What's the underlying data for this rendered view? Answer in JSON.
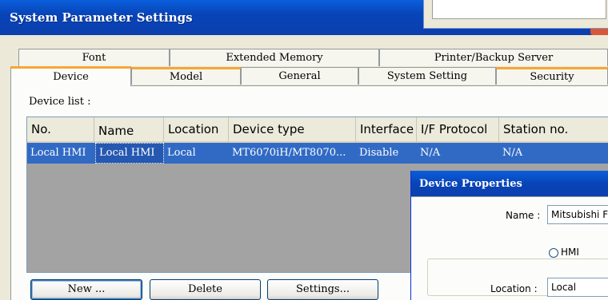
{
  "window": {
    "title": "System Parameter Settings"
  },
  "tabs_back": [
    "Font",
    "Extended Memory",
    "Printer/Backup Server"
  ],
  "tabs_front": [
    "Device",
    "Model",
    "General",
    "System Setting",
    "Security"
  ],
  "active_tab": "Device",
  "device_list": {
    "label": "Device list :",
    "columns": [
      "No.",
      "Name",
      "Location",
      "Device type",
      "Interface",
      "I/F Protocol",
      "Station no."
    ],
    "rows": [
      [
        "Local HMI",
        "Local HMI",
        "Local",
        "MT6070iH/MT8070...",
        "Disable",
        "N/A",
        "N/A"
      ]
    ]
  },
  "buttons": {
    "new": "New ...",
    "delete": "Delete",
    "settings": "Settings..."
  },
  "device_properties": {
    "title": "Device Properties",
    "name_label": "Name :",
    "name_value": "Mitsubishi F",
    "radio_hmi": "HMI",
    "location_label": "Location :",
    "location_value": "Local"
  },
  "colors": {
    "titlebar": "#0844b8",
    "selection": "#316ac5",
    "tab_accent": "#f6a634",
    "face": "#ece9d8"
  }
}
